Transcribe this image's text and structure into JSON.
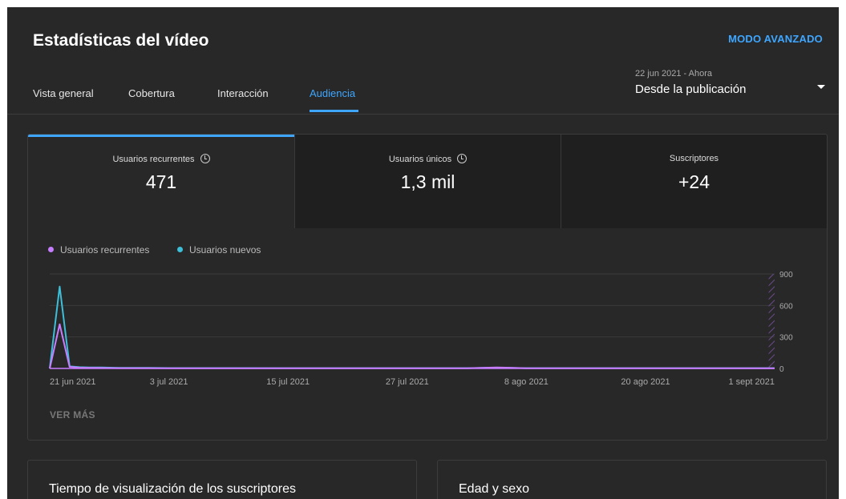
{
  "header": {
    "title": "Estadísticas del vídeo",
    "advanced_mode": "MODO AVANZADO"
  },
  "tabs": [
    {
      "label": "Vista general",
      "active": false
    },
    {
      "label": "Cobertura",
      "active": false
    },
    {
      "label": "Interacción",
      "active": false
    },
    {
      "label": "Audiencia",
      "active": true
    }
  ],
  "period": {
    "range": "22 jun 2021 - Ahora",
    "label": "Desde la publicación"
  },
  "metrics": [
    {
      "label": "Usuarios recurrentes",
      "value": "471",
      "has_info_icon": true,
      "selected": true
    },
    {
      "label": "Usuarios únicos",
      "value": "1,3 mil",
      "has_info_icon": true,
      "selected": false
    },
    {
      "label": "Suscriptores",
      "value": "+24",
      "has_info_icon": false,
      "selected": false
    }
  ],
  "chart_data": {
    "type": "line",
    "x": [
      "2021-06-21",
      "2021-06-22",
      "2021-06-23",
      "2021-06-24",
      "2021-06-25",
      "2021-06-26",
      "2021-06-27",
      "2021-06-28",
      "2021-06-29",
      "2021-06-30",
      "2021-07-01",
      "2021-07-03",
      "2021-07-09",
      "2021-07-15",
      "2021-07-21",
      "2021-07-27",
      "2021-08-02",
      "2021-08-05",
      "2021-08-08",
      "2021-08-14",
      "2021-08-20",
      "2021-08-26",
      "2021-09-01",
      "2021-09-02"
    ],
    "series": [
      {
        "name": "Usuarios recurrentes",
        "color": "#c77dff",
        "values": [
          0,
          420,
          15,
          8,
          5,
          5,
          4,
          3,
          3,
          3,
          3,
          2,
          2,
          2,
          2,
          2,
          2,
          10,
          2,
          2,
          2,
          2,
          2,
          2
        ]
      },
      {
        "name": "Usuarios nuevos",
        "color": "#3dbfd9",
        "values": [
          0,
          780,
          20,
          12,
          10,
          10,
          8,
          6,
          5,
          5,
          5,
          4,
          4,
          3,
          3,
          3,
          3,
          8,
          3,
          3,
          3,
          3,
          3,
          3
        ]
      }
    ],
    "xticks": [
      "21 jun 2021",
      "3 jul 2021",
      "15 jul 2021",
      "27 jul 2021",
      "8 ago 2021",
      "20 ago 2021",
      "1 sept 2021"
    ],
    "yticks": [
      "0",
      "300",
      "600",
      "900"
    ],
    "ylim": [
      0,
      900
    ],
    "y_axis_side": "right",
    "grid": true,
    "legend_position": "top-left",
    "partial_period": "hatched last day"
  },
  "see_more": "VER MÁS",
  "sections": [
    {
      "title": "Tiempo de visualización de los suscriptores"
    },
    {
      "title": "Edad y sexo"
    }
  ]
}
